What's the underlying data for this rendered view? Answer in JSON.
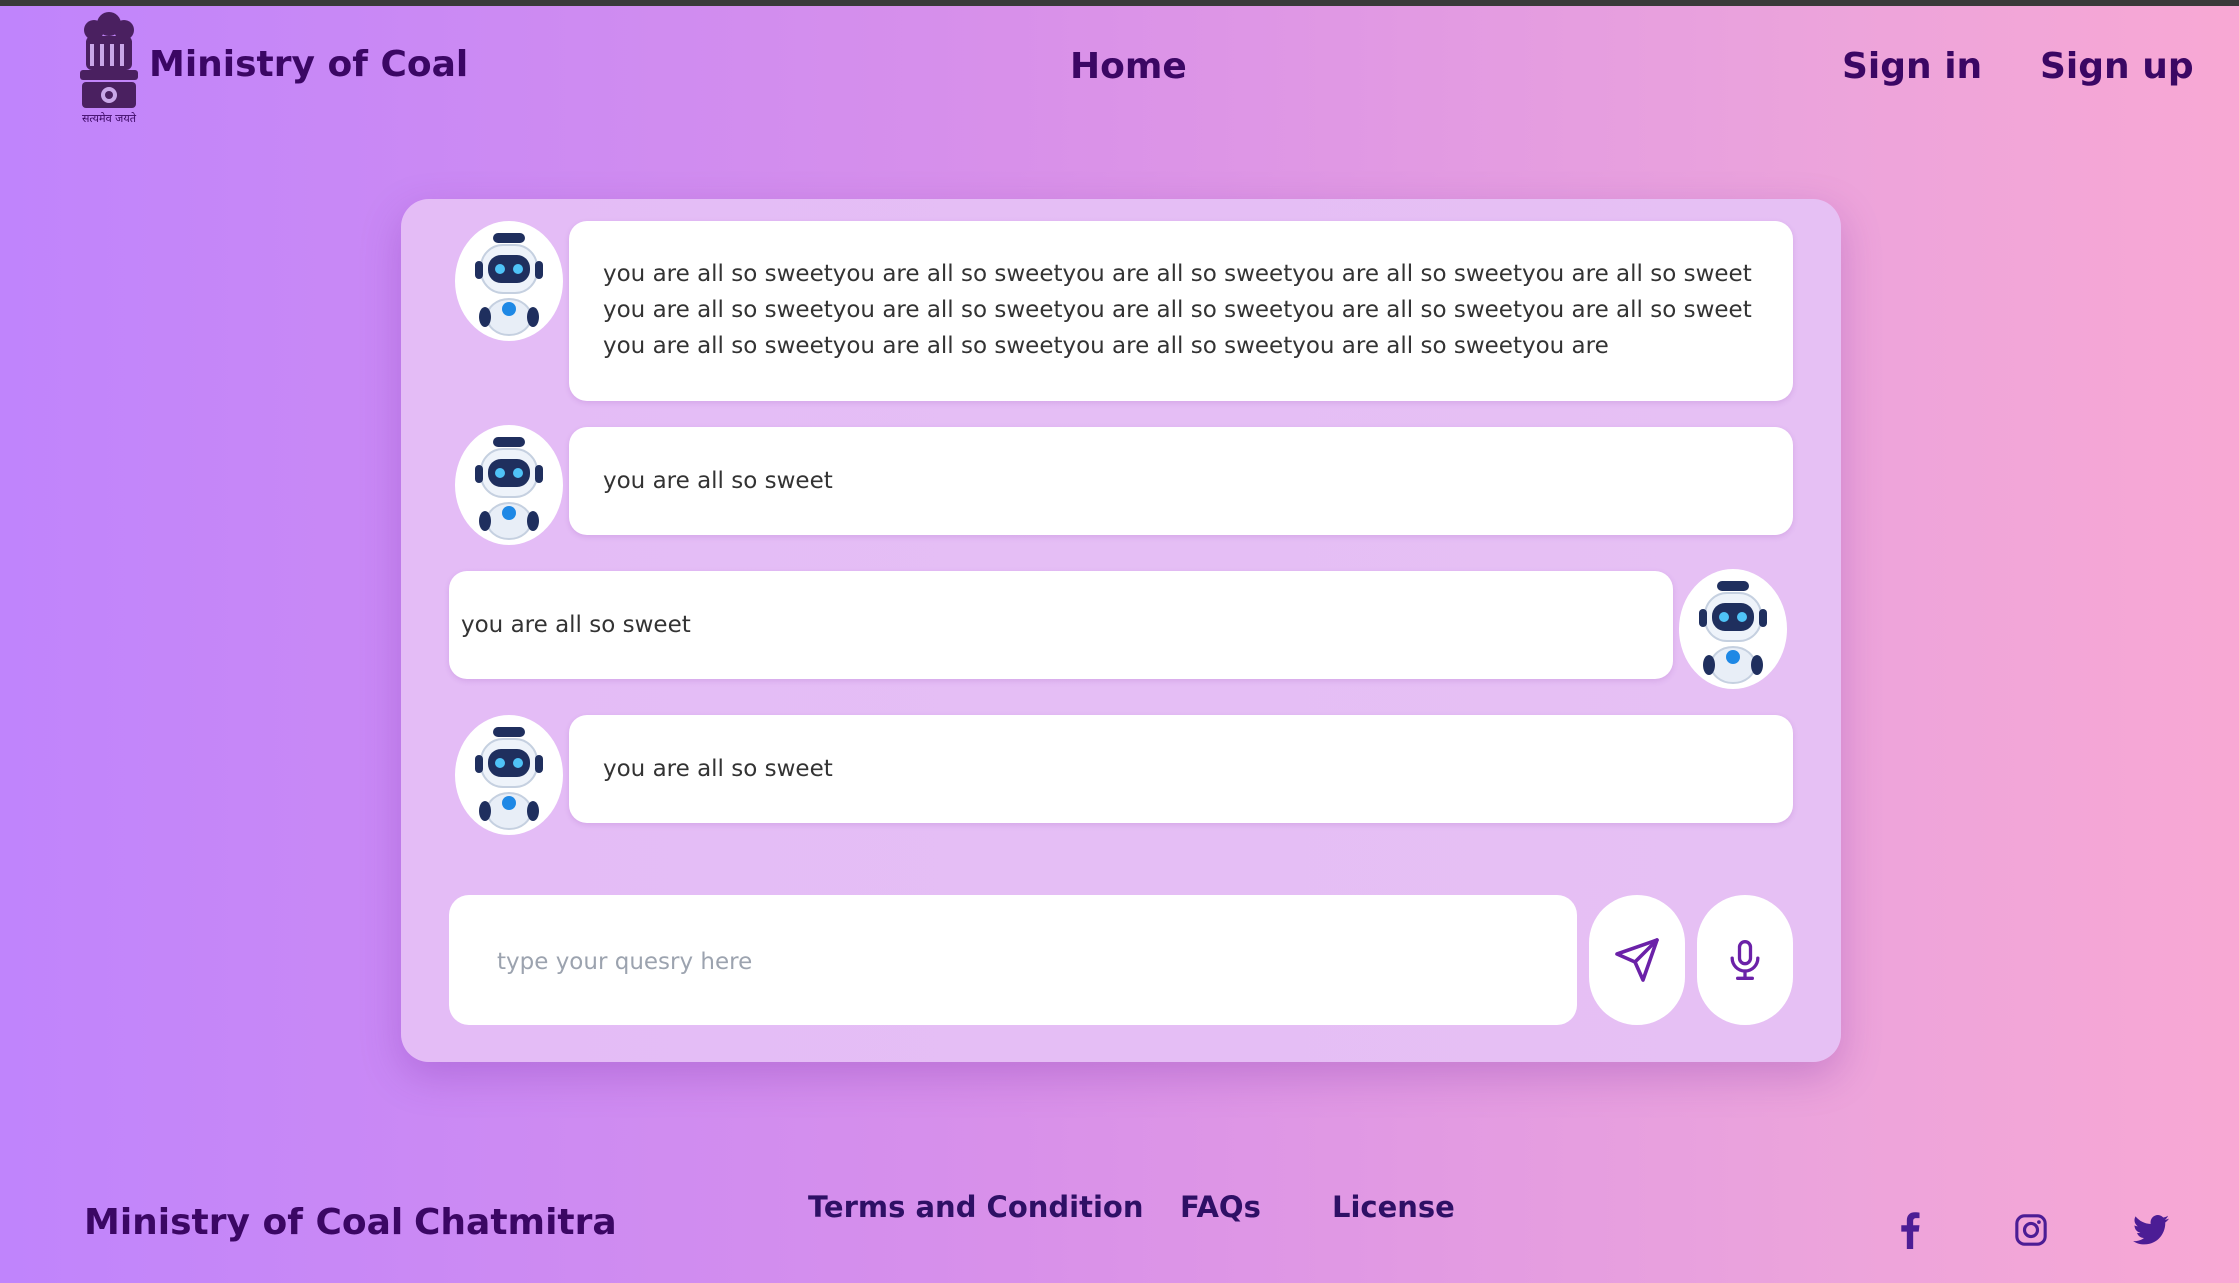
{
  "header": {
    "brand": "Ministry of Coal",
    "emblem_caption": "सत्यमेव जयते",
    "nav": {
      "home": "Home",
      "sign_in": "Sign in",
      "sign_up": "Sign up"
    }
  },
  "chat": {
    "messages": [
      {
        "sender": "bot",
        "text": "you are all so sweetyou are all so sweetyou are all so sweetyou are all so sweetyou are all so sweetyou are all so sweetyou are all so sweetyou are all so sweetyou are all so sweetyou are all so sweetyou are all so sweetyou are all so sweetyou are all so sweetyou are all so sweetyou are"
      },
      {
        "sender": "bot",
        "text": "you are all so sweet"
      },
      {
        "sender": "user",
        "text": "you are all so sweet"
      },
      {
        "sender": "bot",
        "text": "you are all so sweet"
      }
    ],
    "input": {
      "placeholder": "type your quesry here",
      "value": ""
    },
    "send_icon": "send-icon",
    "mic_icon": "microphone-icon"
  },
  "footer": {
    "brand": "Ministry of Coal",
    "product": "Chatmitra",
    "links": {
      "terms": "Terms and Condition",
      "faqs": "FAQs",
      "license": "License"
    },
    "social": [
      "facebook-icon",
      "instagram-icon",
      "twitter-icon"
    ]
  },
  "colors": {
    "primary_text": "#3b0764",
    "icon": "#6b21a8",
    "card": "#e4bcf6",
    "bubble": "#ffffff"
  }
}
